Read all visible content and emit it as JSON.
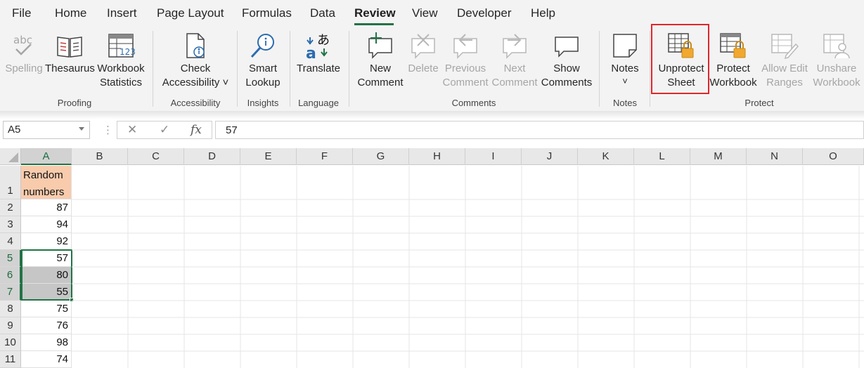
{
  "menu": {
    "items": [
      "File",
      "Home",
      "Insert",
      "Page Layout",
      "Formulas",
      "Data",
      "Review",
      "View",
      "Developer",
      "Help"
    ],
    "active": "Review"
  },
  "ribbon": {
    "proofing": {
      "spelling": "Spelling",
      "thesaurus": "Thesaurus",
      "workbook_statistics_1": "Workbook",
      "workbook_statistics_2": "Statistics",
      "group": "Proofing"
    },
    "accessibility": {
      "check_1": "Check",
      "check_2": "Accessibility ˅",
      "group": "Accessibility"
    },
    "insights": {
      "smart_1": "Smart",
      "smart_2": "Lookup",
      "group": "Insights"
    },
    "language": {
      "translate": "Translate",
      "group": "Language"
    },
    "comments": {
      "new_1": "New",
      "new_2": "Comment",
      "delete": "Delete",
      "previous_1": "Previous",
      "previous_2": "Comment",
      "next_1": "Next",
      "next_2": "Comment",
      "show_1": "Show",
      "show_2": "Comments",
      "group": "Comments"
    },
    "notes": {
      "notes": "Notes",
      "chevron": "˅",
      "group": "Notes"
    },
    "protect": {
      "unprotect_1": "Unprotect",
      "unprotect_2": "Sheet",
      "protect_wb_1": "Protect",
      "protect_wb_2": "Workbook",
      "allow_1": "Allow Edit",
      "allow_2": "Ranges",
      "unshare_1": "Unshare",
      "unshare_2": "Workbook",
      "group": "Protect"
    }
  },
  "formula_bar": {
    "name_box": "A5",
    "cancel_glyph": "✕",
    "enter_glyph": "✓",
    "fx": "fx",
    "value": "57"
  },
  "sheet": {
    "columns": [
      "A",
      "B",
      "C",
      "D",
      "E",
      "F",
      "G",
      "H",
      "I",
      "J",
      "K",
      "L",
      "M",
      "N",
      "O"
    ],
    "rows": [
      "1",
      "2",
      "3",
      "4",
      "5",
      "6",
      "7",
      "8",
      "9",
      "10",
      "11"
    ],
    "a1_line1": "Random",
    "a1_line2": "numbers",
    "values": [
      "87",
      "94",
      "92",
      "57",
      "80",
      "55",
      "75",
      "76",
      "98",
      "74"
    ]
  },
  "colors": {
    "accent": "#217346",
    "highlight": "#e0262d",
    "header_fill": "#f8cbad",
    "lock": "#f0a830"
  }
}
